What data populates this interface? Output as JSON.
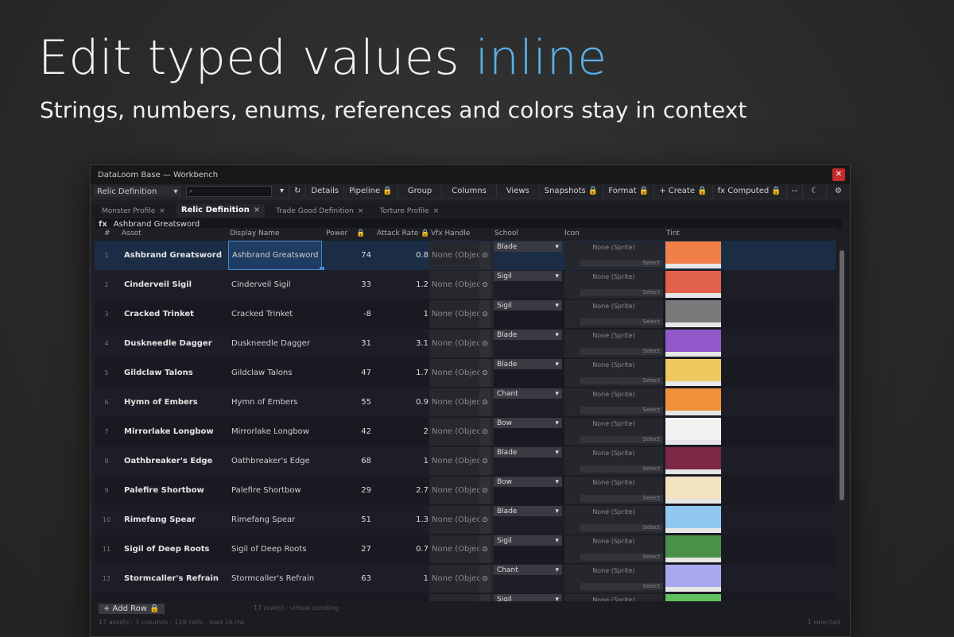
{
  "hero": {
    "title_main": "Edit typed values ",
    "title_accent": "inline",
    "subtitle": "Strings, numbers, enums, references and colors stay in context"
  },
  "window": {
    "title": "DataLoom Base — Workbench",
    "close_label": "✕"
  },
  "toolbar": {
    "type_select": "Relic Definition",
    "search_placeholder": "",
    "buttons": [
      "Details",
      "Pipeline 🔒",
      "Group",
      "Columns",
      "Views",
      "Snapshots 🔒",
      "Format 🔒",
      "+ Create 🔒",
      "fx Computed 🔒",
      "--",
      "☾",
      "⚙"
    ]
  },
  "tabs": [
    {
      "label": "Monster Profile",
      "active": false
    },
    {
      "label": "Relic Definition",
      "active": true
    },
    {
      "label": "Trade Good Definition",
      "active": false
    },
    {
      "label": "Torture Profile",
      "active": false
    }
  ],
  "formula": {
    "fx": "fx",
    "value": "Ashbrand Greatsword"
  },
  "columns": [
    "#",
    "Asset",
    "Display Name",
    "Power",
    "Attack Rate",
    "Vfx Handle",
    "School",
    "Icon",
    "Tint"
  ],
  "rows": [
    {
      "n": "1",
      "asset": "Ashbrand Greatsword",
      "display": "Ashbrand Greatsword",
      "power": "74",
      "rate": "0.8",
      "school": "Blade",
      "tint": "#f08048"
    },
    {
      "n": "2",
      "asset": "Cinderveil Sigil",
      "display": "Cinderveil Sigil",
      "power": "33",
      "rate": "1.2",
      "school": "Sigil",
      "tint": "#e0604a"
    },
    {
      "n": "3",
      "asset": "Cracked Trinket",
      "display": "Cracked Trinket",
      "power": "-8",
      "rate": "1",
      "school": "Sigil",
      "tint": "#7a7a7a"
    },
    {
      "n": "4",
      "asset": "Duskneedle Dagger",
      "display": "Duskneedle Dagger",
      "power": "31",
      "rate": "3.1",
      "school": "Blade",
      "tint": "#9058c8"
    },
    {
      "n": "5",
      "asset": "Gildclaw Talons",
      "display": "Gildclaw Talons",
      "power": "47",
      "rate": "1.7",
      "school": "Blade",
      "tint": "#f0c860"
    },
    {
      "n": "6",
      "asset": "Hymn of Embers",
      "display": "Hymn of Embers",
      "power": "55",
      "rate": "0.9",
      "school": "Chant",
      "tint": "#f09038"
    },
    {
      "n": "7",
      "asset": "Mirrorlake Longbow",
      "display": "Mirrorlake Longbow",
      "power": "42",
      "rate": "2",
      "school": "Bow",
      "tint": "#f2f2f2"
    },
    {
      "n": "8",
      "asset": "Oathbreaker's Edge",
      "display": "Oathbreaker's Edge",
      "power": "68",
      "rate": "1",
      "school": "Blade",
      "tint": "#7a2845"
    },
    {
      "n": "9",
      "asset": "Palefire Shortbow",
      "display": "Palefire Shortbow",
      "power": "29",
      "rate": "2.7",
      "school": "Bow",
      "tint": "#f2e2c0"
    },
    {
      "n": "10",
      "asset": "Rimefang Spear",
      "display": "Rimefang Spear",
      "power": "51",
      "rate": "1.3",
      "school": "Blade",
      "tint": "#90c8f0"
    },
    {
      "n": "11",
      "asset": "Sigil of Deep Roots",
      "display": "Sigil of Deep Roots",
      "power": "27",
      "rate": "0.7",
      "school": "Sigil",
      "tint": "#4a9048"
    },
    {
      "n": "12",
      "asset": "Stormcaller's Refrain",
      "display": "Stormcaller's Refrain",
      "power": "63",
      "rate": "1",
      "school": "Chant",
      "tint": "#a8a8f0"
    },
    {
      "n": "",
      "asset": "",
      "display": "",
      "power": "",
      "rate": "",
      "school": "Sigil",
      "tint": "#60c060"
    }
  ],
  "cell_text": {
    "vfx": "None (Object",
    "sprite": "None (Sprite)",
    "select": "Select"
  },
  "footer": {
    "add_row": "+ Add Row 🔒",
    "virtual": "17 row(s) - virtual scrolling",
    "status": "17 assets - 7 columns - 119 cells - load 16 ms",
    "selected": "1 selected"
  },
  "colors": {
    "accent": "#5aaee8",
    "selection": "#1a2d45",
    "edit_border": "#4a8ad0"
  }
}
